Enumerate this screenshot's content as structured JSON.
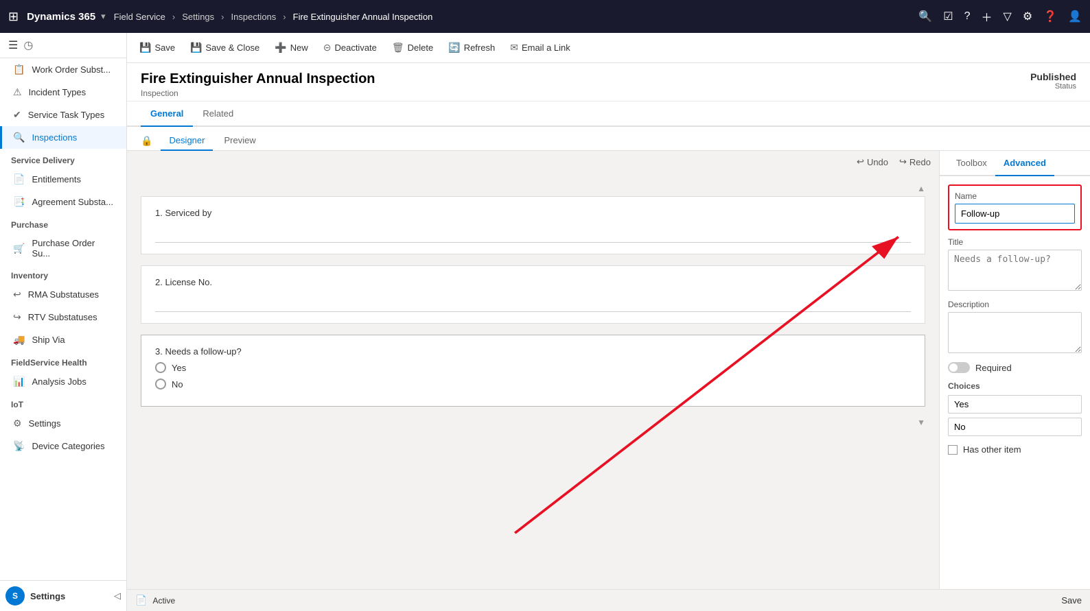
{
  "topnav": {
    "waffle": "⊞",
    "app_name": "Dynamics 365",
    "module": "Field Service",
    "breadcrumb": [
      "Settings",
      "Inspections",
      "Fire Extinguisher Annual Inspection"
    ],
    "icons": [
      "🔍",
      "✓",
      "?",
      "+",
      "▼",
      "⚙",
      "?",
      "👤"
    ]
  },
  "sidebar": {
    "toggle_icon": "☰",
    "history_icon": "◷",
    "items_top": [
      {
        "id": "work-order-subst",
        "label": "Work Order Subst...",
        "icon": "📋"
      },
      {
        "id": "incident-types",
        "label": "Incident Types",
        "icon": "⚠"
      },
      {
        "id": "service-task-types",
        "label": "Service Task Types",
        "icon": "✔"
      },
      {
        "id": "inspections",
        "label": "Inspections",
        "icon": "🔍"
      }
    ],
    "section_service_delivery": "Service Delivery",
    "items_service": [
      {
        "id": "entitlements",
        "label": "Entitlements",
        "icon": "📄"
      },
      {
        "id": "agreement-substa",
        "label": "Agreement Substa...",
        "icon": "📑"
      }
    ],
    "section_purchase": "Purchase",
    "items_purchase": [
      {
        "id": "purchase-order-su",
        "label": "Purchase Order Su...",
        "icon": "🛒"
      }
    ],
    "section_inventory": "Inventory",
    "items_inventory": [
      {
        "id": "rma-substatuses",
        "label": "RMA Substatuses",
        "icon": "↩"
      },
      {
        "id": "rtv-substatuses",
        "label": "RTV Substatuses",
        "icon": "↪"
      },
      {
        "id": "ship-via",
        "label": "Ship Via",
        "icon": "🚚"
      }
    ],
    "section_fieldservice": "FieldService Health",
    "items_fieldservice": [
      {
        "id": "analysis-jobs",
        "label": "Analysis Jobs",
        "icon": "📊"
      }
    ],
    "section_iot": "IoT",
    "items_iot": [
      {
        "id": "settings",
        "label": "Settings",
        "icon": "⚙"
      },
      {
        "id": "device-categories",
        "label": "Device Categories",
        "icon": "📡"
      }
    ],
    "bottom_label": "Settings",
    "avatar_letter": "S"
  },
  "toolbar": {
    "save_label": "Save",
    "save_close_label": "Save & Close",
    "new_label": "New",
    "deactivate_label": "Deactivate",
    "delete_label": "Delete",
    "refresh_label": "Refresh",
    "email_link_label": "Email a Link"
  },
  "record": {
    "title": "Fire Extinguisher Annual Inspection",
    "type": "Inspection",
    "status_value": "Published",
    "status_label": "Status"
  },
  "tabs": {
    "items": [
      "General",
      "Related"
    ],
    "active": "General"
  },
  "sub_tabs": {
    "items": [
      "Designer",
      "Preview"
    ],
    "active": "Designer"
  },
  "canvas": {
    "undo_label": "Undo",
    "redo_label": "Redo",
    "fields": [
      {
        "id": "field-1",
        "label": "1. Serviced by",
        "type": "text"
      },
      {
        "id": "field-2",
        "label": "2. License No.",
        "type": "text"
      },
      {
        "id": "field-3",
        "label": "3. Needs a follow-up?",
        "type": "radio",
        "options": [
          "Yes",
          "No"
        ]
      }
    ]
  },
  "right_panel": {
    "tabs": [
      "Toolbox",
      "Advanced"
    ],
    "active_tab": "Advanced",
    "name_label": "Name",
    "name_value": "Follow-up",
    "title_label": "Title",
    "title_placeholder": "Needs a follow-up?",
    "description_label": "Description",
    "description_value": "",
    "required_label": "Required",
    "choices_label": "Choices",
    "choices": [
      "Yes",
      "No"
    ],
    "has_other_label": "Has other item"
  },
  "status_bar": {
    "status_value": "Active",
    "save_label": "Save"
  }
}
